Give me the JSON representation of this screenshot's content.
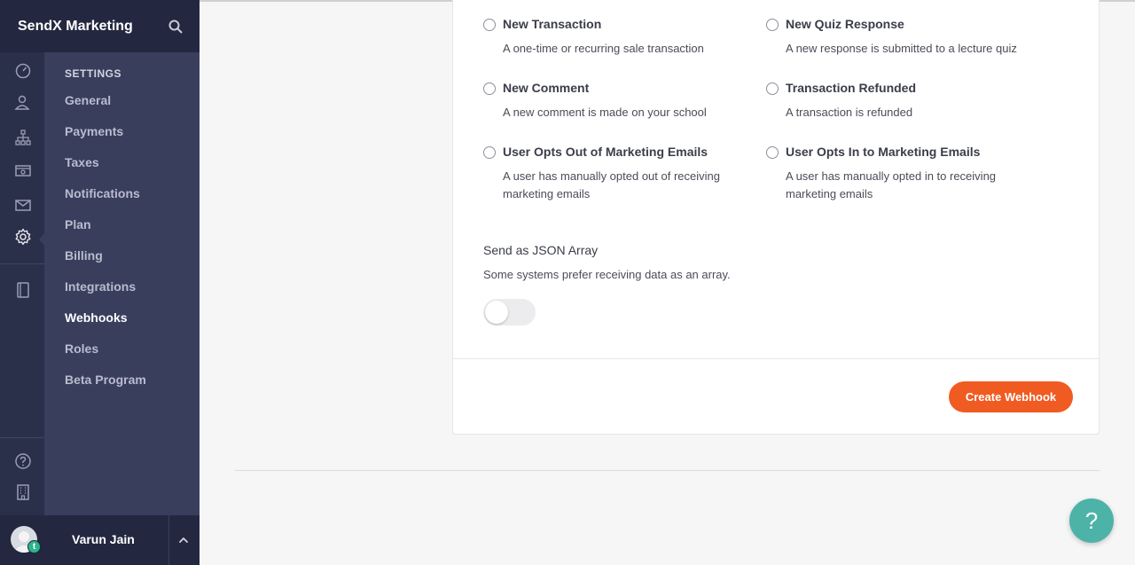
{
  "brand": {
    "name": "SendX Marketing",
    "search_icon": "search-icon"
  },
  "rail": {
    "icons": [
      "dashboard-icon",
      "users-icon",
      "sitemap-icon",
      "sales-icon",
      "mail-icon",
      "gear-icon",
      "book-icon",
      "help-circle-icon",
      "building-icon"
    ],
    "active": "gear-icon"
  },
  "settings": {
    "heading": "SETTINGS",
    "items": [
      {
        "label": "General"
      },
      {
        "label": "Payments"
      },
      {
        "label": "Taxes"
      },
      {
        "label": "Notifications"
      },
      {
        "label": "Plan"
      },
      {
        "label": "Billing"
      },
      {
        "label": "Integrations"
      },
      {
        "label": "Webhooks",
        "active": true
      },
      {
        "label": "Roles"
      },
      {
        "label": "Beta Program"
      }
    ]
  },
  "user": {
    "name": "Varun Jain",
    "badge": "t"
  },
  "events": [
    {
      "title": "New Transaction",
      "desc": "A one-time or recurring sale transaction"
    },
    {
      "title": "New Quiz Response",
      "desc": "A new response is submitted to a lecture quiz"
    },
    {
      "title": "New Comment",
      "desc": "A new comment is made on your school"
    },
    {
      "title": "Transaction Refunded",
      "desc": "A transaction is refunded"
    },
    {
      "title": "User Opts Out of Marketing Emails",
      "desc": "A user has manually opted out of receiving marketing emails"
    },
    {
      "title": "User Opts In to Marketing Emails",
      "desc": "A user has manually opted in to receiving marketing emails"
    }
  ],
  "json_array": {
    "title": "Send as JSON Array",
    "desc": "Some systems prefer receiving data as an array.",
    "enabled": false
  },
  "actions": {
    "create_label": "Create Webhook"
  },
  "help_fab": {
    "label": "?"
  },
  "colors": {
    "accent": "#f05b22",
    "sidebar": "#393e5d",
    "fab": "#4db3a8"
  }
}
